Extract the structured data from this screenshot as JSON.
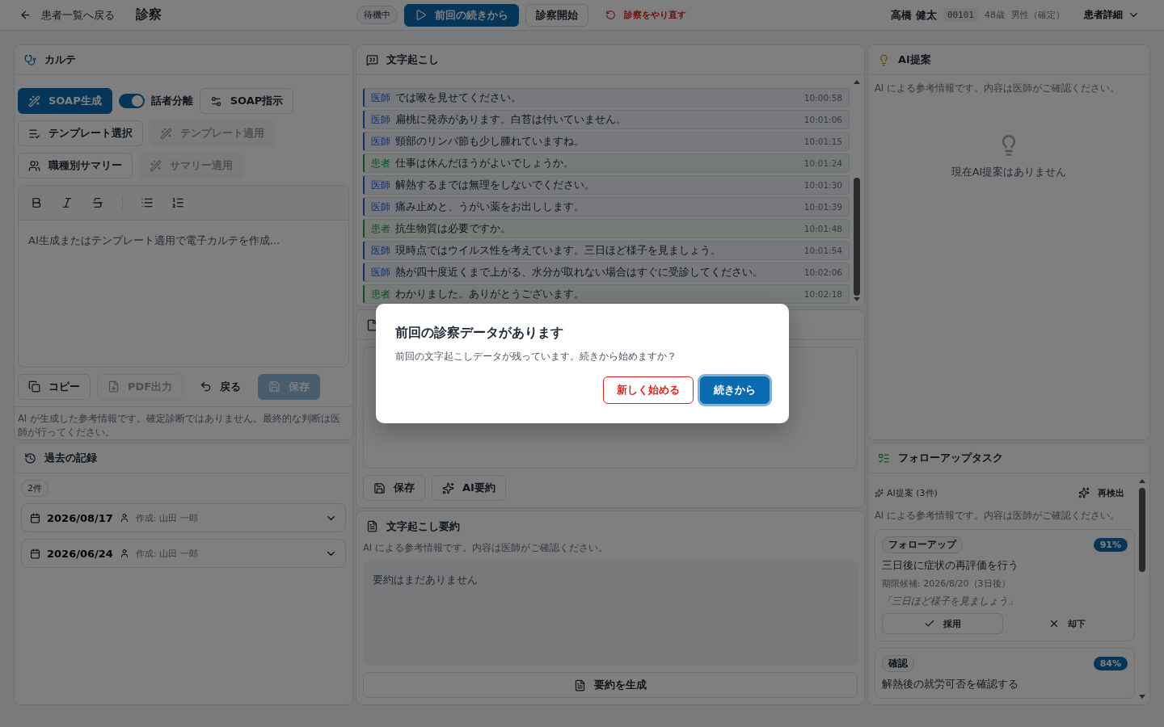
{
  "header": {
    "back": "患者一覧へ戻る",
    "title": "診察",
    "status": "待機中",
    "actions": [
      {
        "label": "前回の続きから",
        "kind": "primary"
      },
      {
        "label": "診察開始",
        "kind": "outline"
      },
      {
        "label": "診察をやり直す",
        "kind": "danger"
      }
    ],
    "patient": {
      "name": "高橋 健太",
      "id": "00101",
      "age": "48歳",
      "sex": "男性（確定）"
    },
    "details": "患者詳細"
  },
  "chart": {
    "title": "カルテ",
    "tools": [
      {
        "label": "SOAP生成",
        "kind": "primary",
        "disabled": false
      },
      {
        "label": "話者分離",
        "kind": "toggle",
        "on": true
      },
      {
        "label": "SOAP指示",
        "kind": "outline",
        "disabled": false
      },
      {
        "label": "テンプレート選択",
        "kind": "outline",
        "disabled": false
      },
      {
        "label": "テンプレート適用",
        "kind": "soft",
        "disabled": true
      },
      {
        "label": "職種別サマリー",
        "kind": "outline",
        "disabled": false
      },
      {
        "label": "サマリー適用",
        "kind": "soft",
        "disabled": true
      }
    ],
    "editor": {
      "placeholder": "AI生成またはテンプレート適用で電子カルテを作成..."
    },
    "actions": [
      {
        "label": "コピー",
        "kind": "outline",
        "disabled": false
      },
      {
        "label": "PDF出力",
        "kind": "outline",
        "disabled": true
      },
      {
        "label": "戻る",
        "kind": "ghost",
        "disabled": false
      },
      {
        "label": "保存",
        "kind": "primary",
        "disabled": true
      }
    ],
    "disclaimer": "AI が生成した参考情報です。確定診断ではありません。最終的な判断は医師が行ってください。"
  },
  "history": {
    "title": "過去の記録",
    "count": "2件",
    "records": [
      {
        "date": "2026/08/17",
        "author": "作成: 山田 一郎",
        "expanded": false
      },
      {
        "date": "2026/06/24",
        "author": "作成: 山田 一郎",
        "expanded": false
      }
    ]
  },
  "transcript": {
    "title": "文字起こし",
    "entries": [
      {
        "kind": "doctor",
        "speaker": "医師",
        "text": "では喉を見せてください。",
        "time": "10:00:58"
      },
      {
        "kind": "doctor",
        "speaker": "医師",
        "text": "扁桃に発赤があります。白苔は付いていません。",
        "time": "10:01:06"
      },
      {
        "kind": "doctor",
        "speaker": "医師",
        "text": "頸部のリンパ節も少し腫れていますね。",
        "time": "10:01:15"
      },
      {
        "kind": "patient",
        "speaker": "患者",
        "text": "仕事は休んだほうがよいでしょうか。",
        "time": "10:01:24"
      },
      {
        "kind": "doctor",
        "speaker": "医師",
        "text": "解熱するまでは無理をしないでください。",
        "time": "10:01:30"
      },
      {
        "kind": "doctor",
        "speaker": "医師",
        "text": "痛み止めと、うがい薬をお出しします。",
        "time": "10:01:39"
      },
      {
        "kind": "patient",
        "speaker": "患者",
        "text": "抗生物質は必要ですか。",
        "time": "10:01:48"
      },
      {
        "kind": "doctor",
        "speaker": "医師",
        "text": "現時点ではウイルス性を考えています。三日ほど様子を見ましょう。",
        "time": "10:01:54"
      },
      {
        "kind": "doctor",
        "speaker": "医師",
        "text": "熱が四十度近くまで上がる、水分が取れない場合はすぐに受診してください。",
        "time": "10:02:06"
      },
      {
        "kind": "patient",
        "speaker": "患者",
        "text": "わかりました。ありがとうございます。",
        "time": "10:02:18"
      }
    ]
  },
  "memo": {
    "actions": [
      "保存",
      "AI要約"
    ]
  },
  "summary": {
    "title": "文字起こし要約",
    "note": "AI による参考情報です。内容は医師がご確認ください。",
    "empty": "要約はまだありません",
    "action": "要約を生成"
  },
  "suggestions": {
    "title": "AI提案",
    "note": "AI による参考情報です。内容は医師がご確認ください。",
    "empty": "現在AI提案はありません"
  },
  "followup": {
    "title": "フォローアップタスク",
    "subtitle": "AI提案 (3件)",
    "redetect": "再検出",
    "note": "AI による参考情報です。内容は医師がご確認ください。",
    "tasks": [
      {
        "tag": "フォローアップ",
        "score": "91%",
        "title": "三日後に症状の再評価を行う",
        "due": "期限候補: 2026/8/20（3日後）",
        "quote": "「三日ほど様子を見ましょう」",
        "accept": "採用",
        "reject": "却下"
      },
      {
        "tag": "確認",
        "score": "84%",
        "title": "解熱後の就労可否を確認する"
      }
    ]
  },
  "dialog": {
    "title": "前回の診察データがあります",
    "message": "前回の文字起こしデータが残っています。続きから始めますか？",
    "buttons": [
      {
        "label": "新しく始める",
        "kind": "secondary"
      },
      {
        "label": "続きから",
        "kind": "primary"
      }
    ]
  }
}
